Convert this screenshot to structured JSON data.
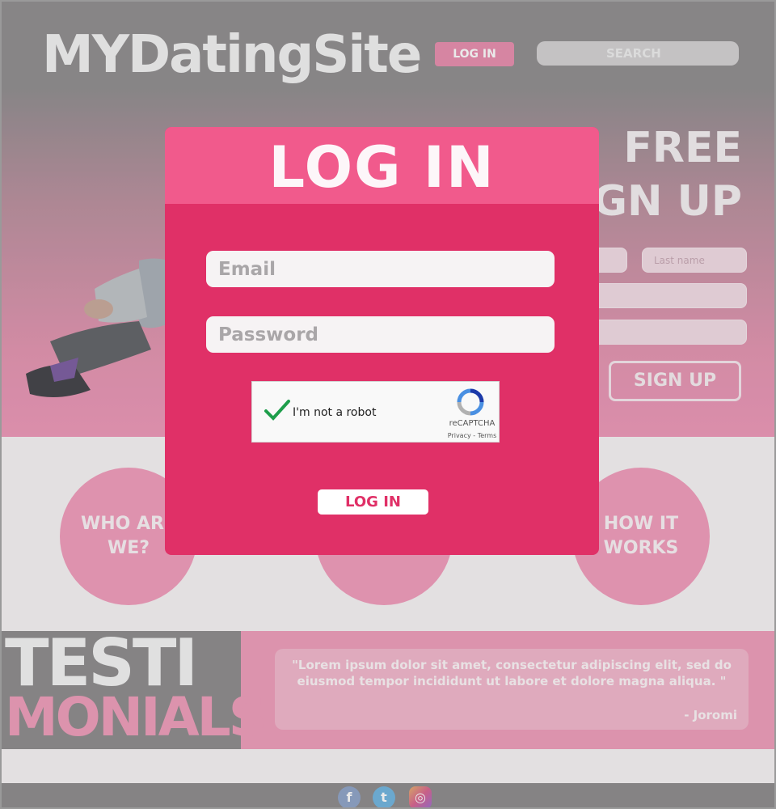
{
  "header": {
    "logo": "MYDatingSite",
    "login_label": "LOG IN",
    "search_placeholder": "SEARCH"
  },
  "signup": {
    "title_line1": "FREE",
    "title_line2": "SIGN UP",
    "lastname_placeholder": "Last name",
    "button_label": "SIGN UP"
  },
  "features": [
    {
      "label": "WHO ARE WE?"
    },
    {
      "label": ""
    },
    {
      "label": "HOW IT WORKS"
    }
  ],
  "testimonials": {
    "heading_line1": "TESTI",
    "heading_line2": "MONIALS",
    "quote": "\"Lorem ipsum dolor sit amet, consectetur adipiscing elit, sed do eiusmod tempor incididunt ut labore et dolore magna aliqua. \"",
    "author": "- Joromi"
  },
  "footer": {
    "social": [
      "facebook-icon",
      "twitter-icon",
      "instagram-icon"
    ]
  },
  "modal": {
    "title": "LOG IN",
    "email_placeholder": "Email",
    "password_placeholder": "Password",
    "captcha_label": "I'm not a robot",
    "captcha_brand": "reCAPTCHA",
    "captcha_links": "Privacy - Terms",
    "login_button": "LOG IN"
  },
  "colors": {
    "modal_body": "#e03067",
    "modal_header": "#f15a8c",
    "accent_pink": "#ef9cba"
  }
}
